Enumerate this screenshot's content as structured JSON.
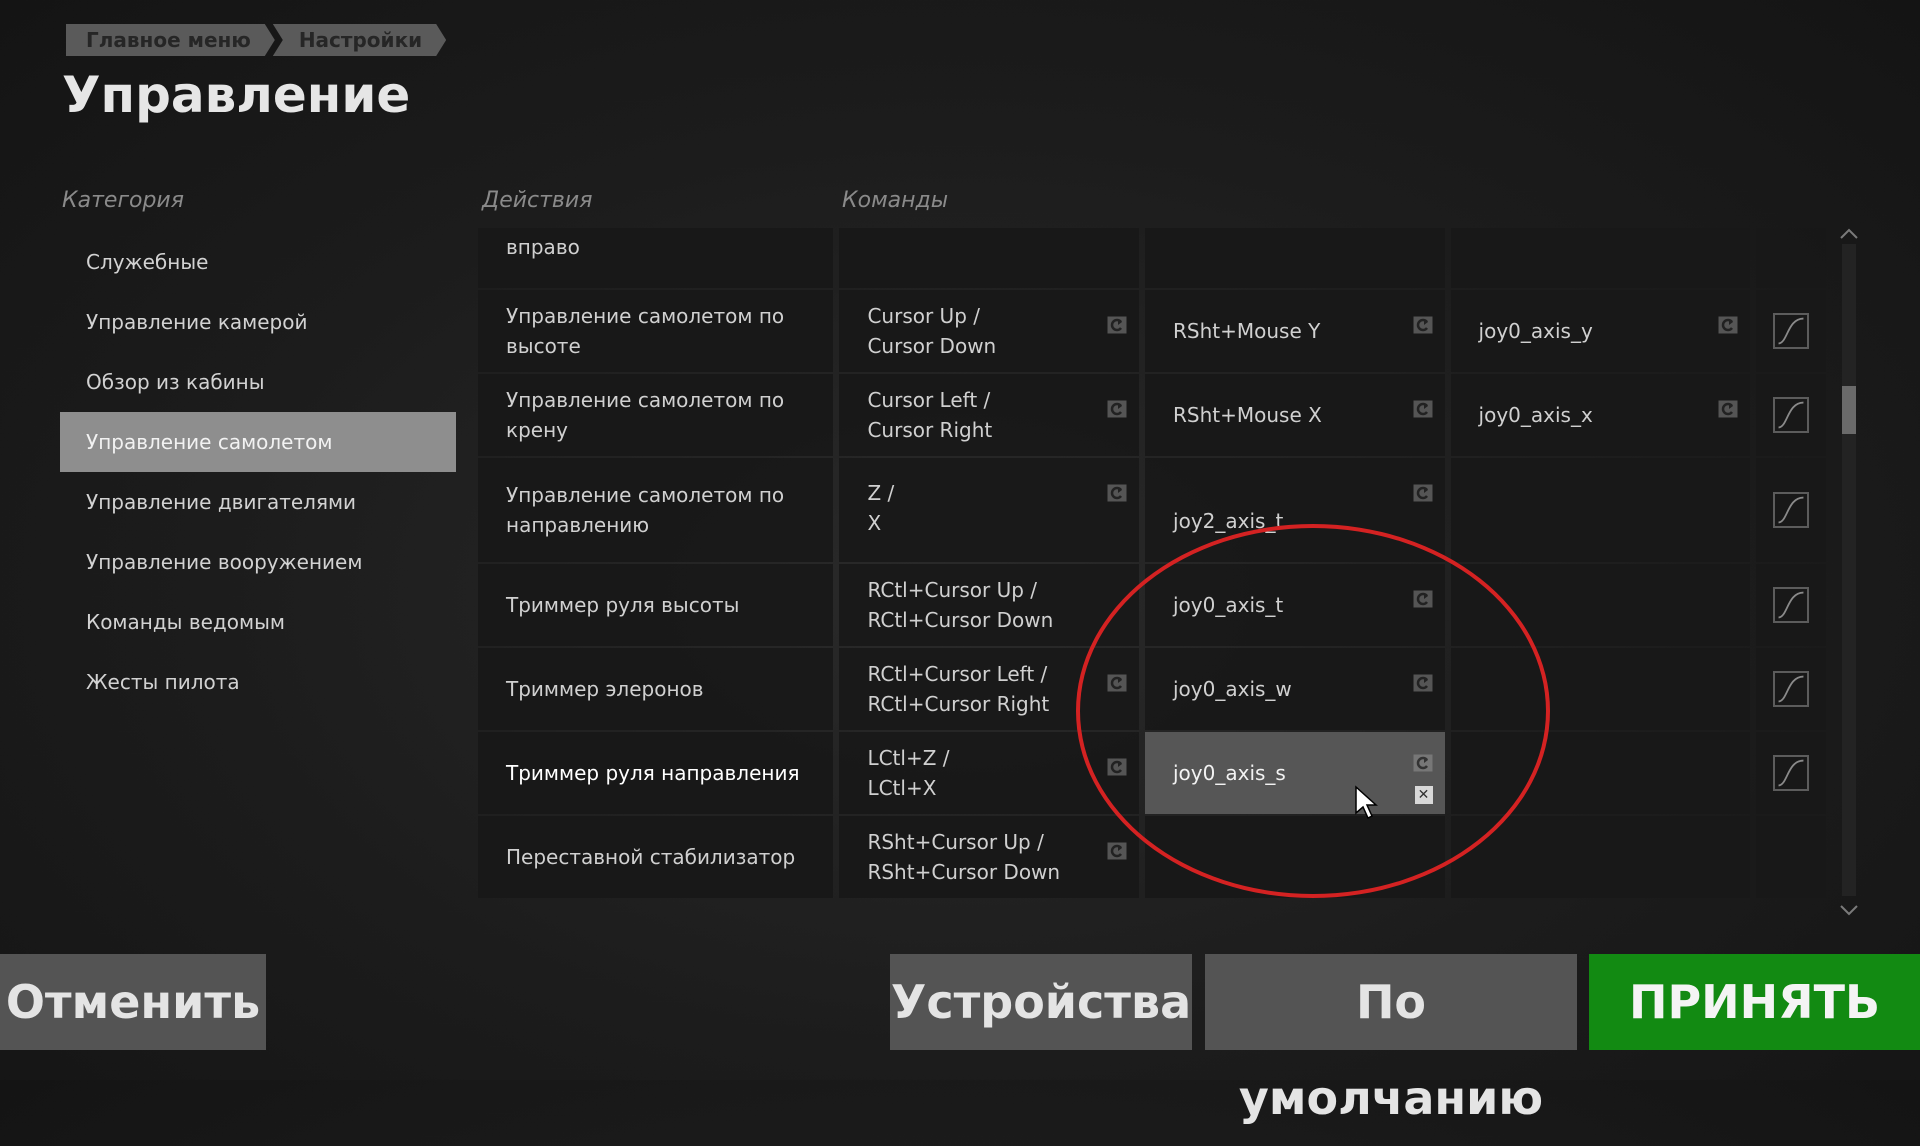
{
  "breadcrumb": {
    "item1": "Главное меню",
    "item2": "Настройки"
  },
  "title": "Управление",
  "headers": {
    "category": "Категория",
    "actions": "Действия",
    "commands": "Команды"
  },
  "categories": [
    "Служебные",
    "Управление камерой",
    "Обзор из кабины",
    "Управление самолетом",
    "Управление двигателями",
    "Управление вооружением",
    "Команды ведомым",
    "Жесты пилота"
  ],
  "selected_category": "Управление самолетом",
  "rows": [
    {
      "action": "вправо",
      "bind1": [
        "",
        ""
      ],
      "bind2": "",
      "bind3": ""
    },
    {
      "action": "Управление самолетом по высоте",
      "bind1": [
        "Cursor Up /",
        "Cursor Down"
      ],
      "bind2": "RSht+Mouse Y",
      "bind3": "joy0_axis_y"
    },
    {
      "action": "Управление самолетом по крену",
      "bind1": [
        "Cursor Left /",
        "Cursor Right"
      ],
      "bind2": "RSht+Mouse X",
      "bind3": "joy0_axis_x"
    },
    {
      "action": "Управление самолетом по направлению",
      "bind1": [
        "Z /",
        "X"
      ],
      "bind2": "joy2_axis_t",
      "bind3": ""
    },
    {
      "action": "Триммер руля высоты",
      "bind1": [
        "RCtl+Cursor Up /",
        "RCtl+Cursor Down"
      ],
      "bind2": "joy0_axis_t",
      "bind3": ""
    },
    {
      "action": "Триммер элеронов",
      "bind1": [
        "RCtl+Cursor Left /",
        "RCtl+Cursor Right"
      ],
      "bind2": "joy0_axis_w",
      "bind3": ""
    },
    {
      "action": "Триммер руля направления",
      "bind1": [
        "LCtl+Z /",
        "LCtl+X"
      ],
      "bind2": "joy0_axis_s",
      "bind3": ""
    },
    {
      "action": "Переставной стабилизатор",
      "bind1": [
        "RSht+Cursor Up /",
        "RSht+Cursor Down"
      ],
      "bind2": "",
      "bind3": ""
    }
  ],
  "buttons": {
    "cancel": "Отменить",
    "devices": "Устройства",
    "defaults": "По умолчанию",
    "accept": "ПРИНЯТЬ"
  },
  "colors": {
    "accent_green": "#128a12",
    "highlight_circle": "#d42222",
    "selected_cell": "#565656"
  },
  "icons": {
    "reset": "reset-icon",
    "clear": "clear-icon",
    "curve": "curve-icon",
    "scroll_up": "chevron-up-icon",
    "scroll_down": "chevron-down-icon",
    "cursor": "mouse-cursor-icon"
  }
}
